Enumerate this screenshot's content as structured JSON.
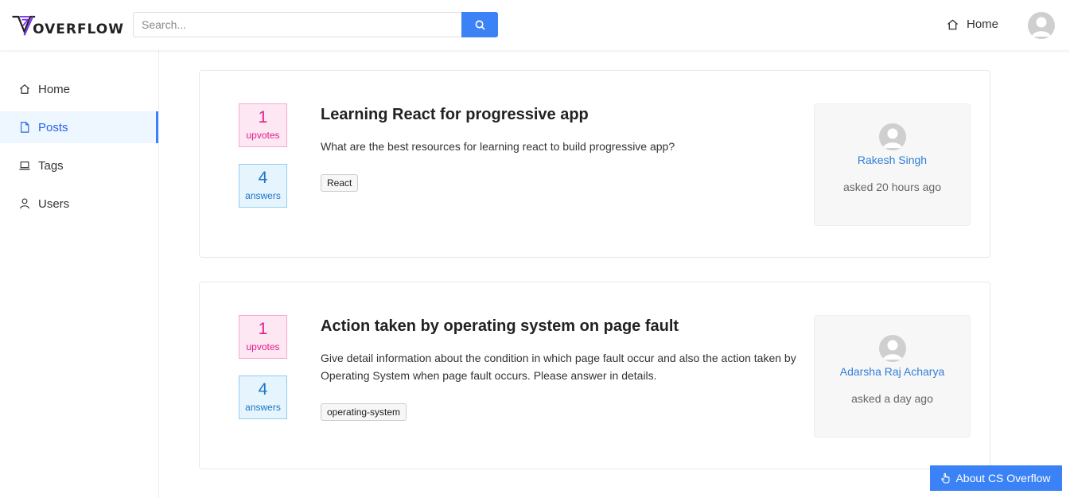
{
  "header": {
    "logo_text": "OVERFLOW",
    "search_placeholder": "Search...",
    "nav_home_label": "Home"
  },
  "sidebar": {
    "items": [
      {
        "label": "Home",
        "icon": "home-icon",
        "active": false
      },
      {
        "label": "Posts",
        "icon": "file-icon",
        "active": true
      },
      {
        "label": "Tags",
        "icon": "laptop-icon",
        "active": false
      },
      {
        "label": "Users",
        "icon": "user-icon",
        "active": false
      }
    ]
  },
  "posts": [
    {
      "upvotes": "1",
      "upvotes_label": "upvotes",
      "answers": "4",
      "answers_label": "answers",
      "title": "Learning React for progressive app",
      "body": "What are the best resources for learning react to build progressive app?",
      "tag": "React",
      "author": "Rakesh Singh",
      "asked": "asked 20 hours ago"
    },
    {
      "upvotes": "1",
      "upvotes_label": "upvotes",
      "answers": "4",
      "answers_label": "answers",
      "title": "Action taken by operating system on page fault",
      "body": "Give detail information about the condition in which page fault occur and also the action taken by Operating System when page fault occurs. Please answer in details.",
      "tag": "operating-system",
      "author": "Adarsha Raj Acharya",
      "asked": "asked a day ago"
    }
  ],
  "about_button_label": "About CS Overflow",
  "colors": {
    "accent": "#3b82f6",
    "upvote": "#e11d8a",
    "answers": "#1d74c9",
    "author_link": "#2f7fd8"
  }
}
